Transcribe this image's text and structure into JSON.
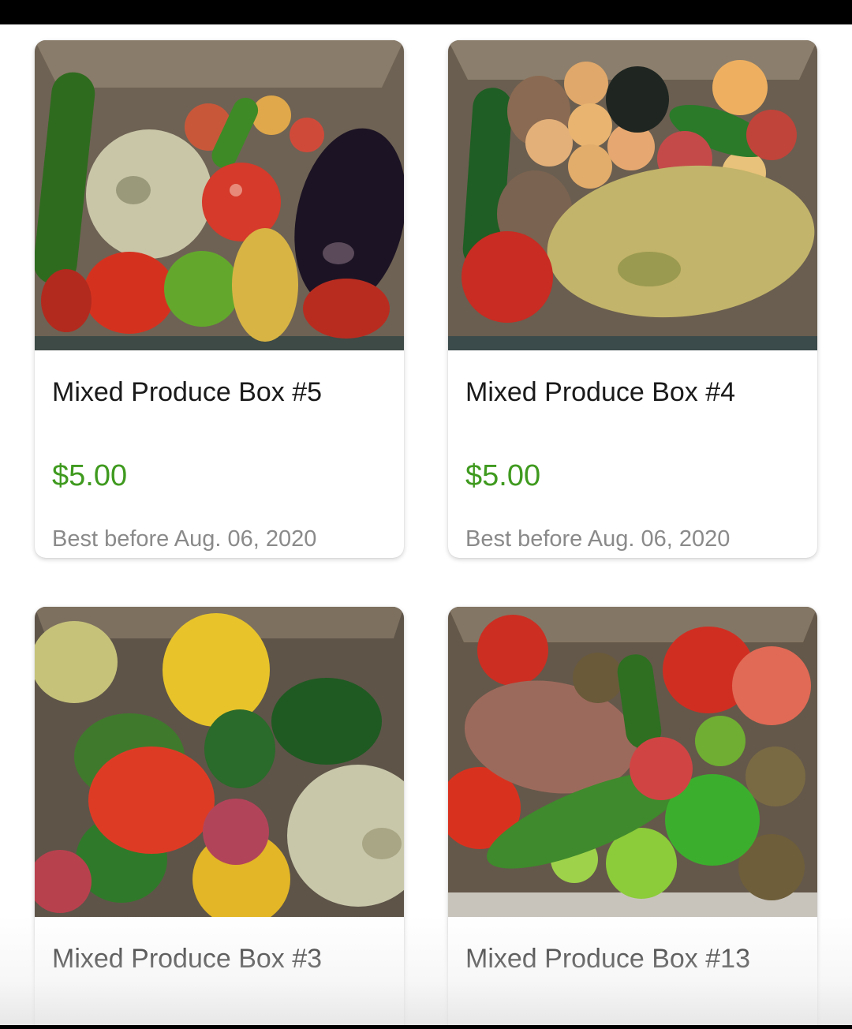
{
  "products": [
    {
      "title": "Mixed Produce Box #5",
      "price": "$5.00",
      "expiry": "Best before Aug. 06, 2020",
      "image_icon": "produce-box-photo"
    },
    {
      "title": "Mixed Produce Box #4",
      "price": "$5.00",
      "expiry": "Best before Aug. 06, 2020",
      "image_icon": "produce-box-photo"
    },
    {
      "title": "Mixed Produce Box #3",
      "price": "",
      "expiry": "",
      "image_icon": "produce-box-photo"
    },
    {
      "title": "Mixed Produce Box #13",
      "price": "",
      "expiry": "",
      "image_icon": "produce-box-photo"
    }
  ],
  "colors": {
    "price": "#3f9a1f",
    "title": "#1a1a1a",
    "expiry": "#8a8a8a",
    "status_bar": "#000000"
  }
}
